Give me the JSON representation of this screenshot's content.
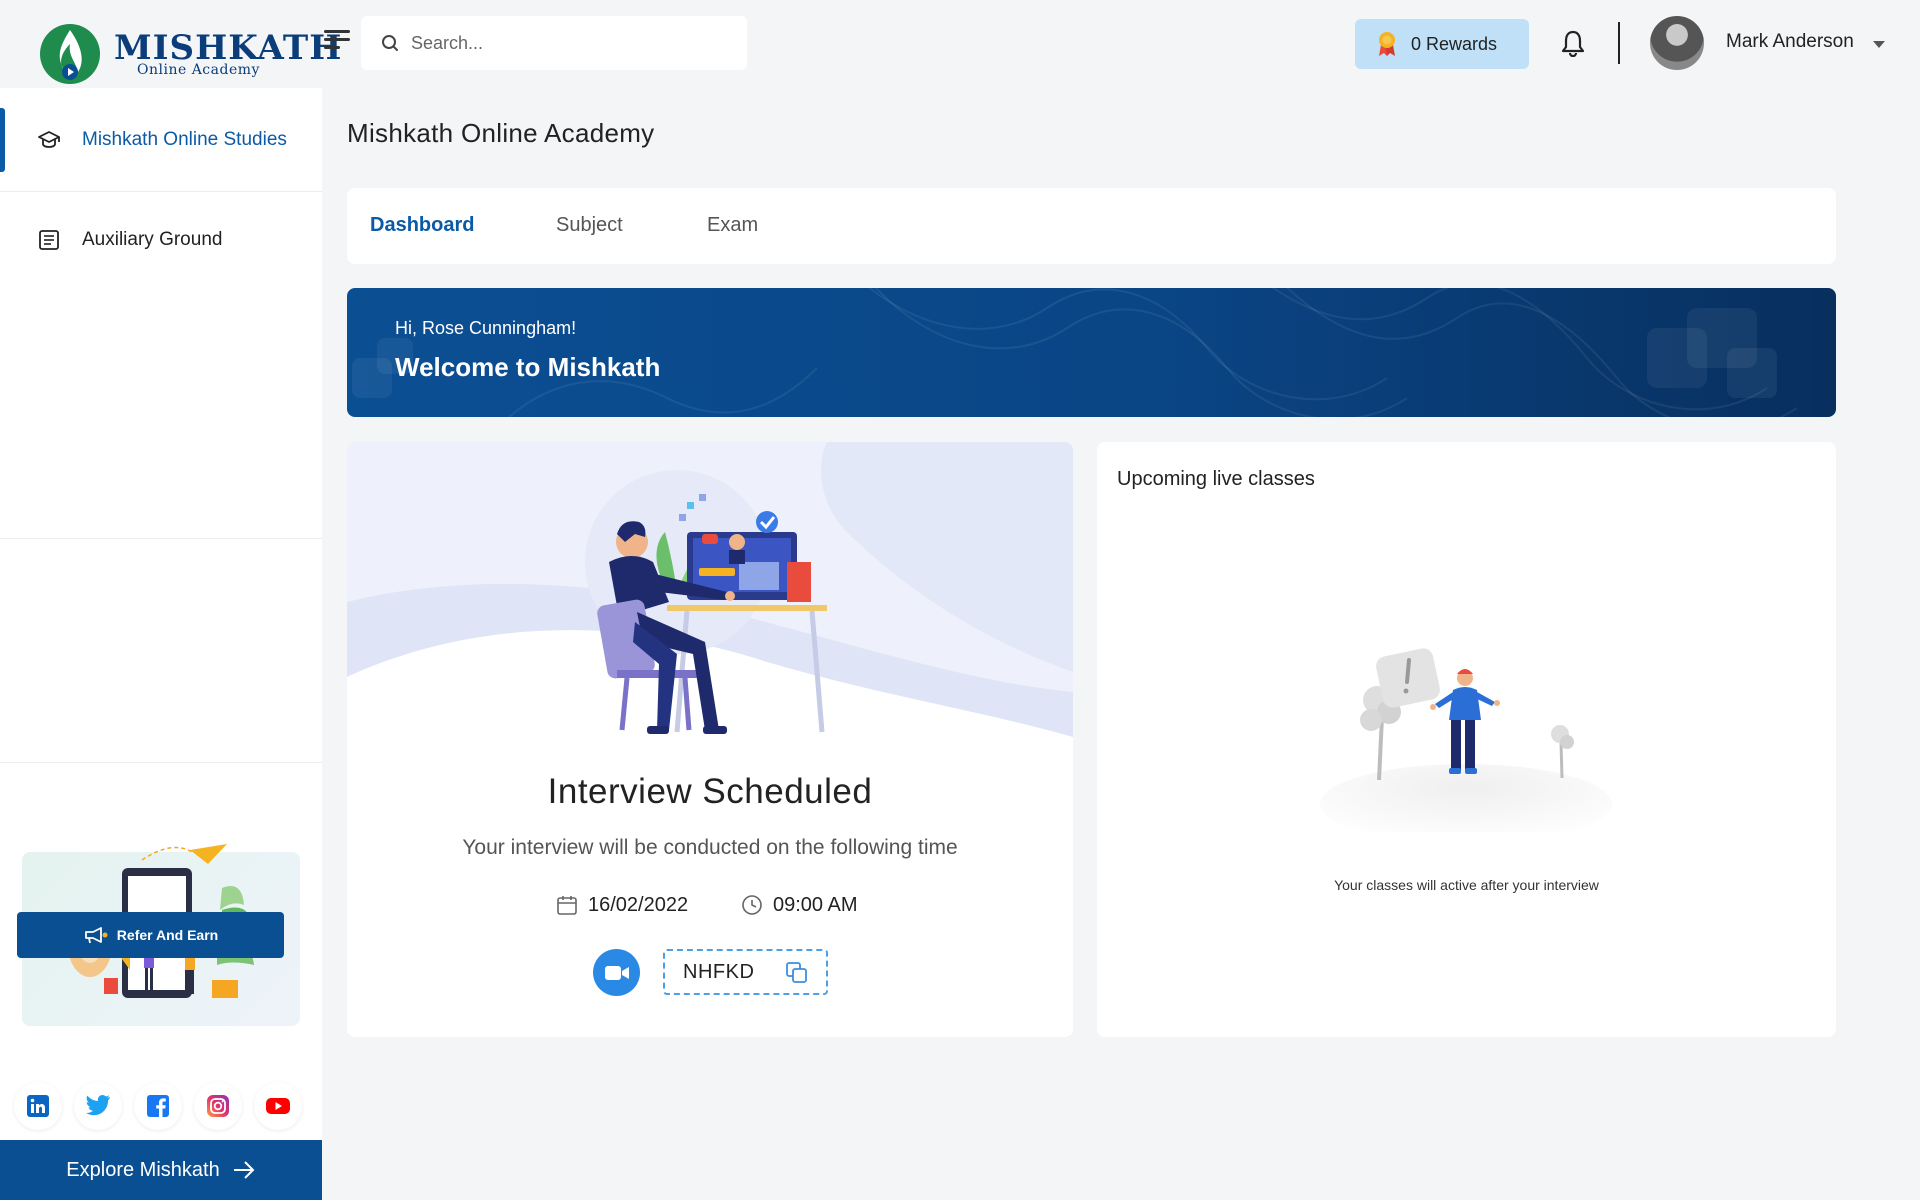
{
  "brand": {
    "name": "MISHKATH",
    "subtitle": "Online Academy",
    "color_primary": "#0b4f93",
    "color_accent": "#0b5aa8"
  },
  "header": {
    "search_placeholder": "Search...",
    "rewards_label": "0 Rewards",
    "user_name": "Mark Anderson",
    "icons": [
      "menu-icon",
      "search-icon",
      "award-icon",
      "bell-icon",
      "chevron-down-icon"
    ]
  },
  "sidebar": {
    "items": [
      {
        "label": "Mishkath Online Studies",
        "icon": "graduation-cap-icon",
        "active": true
      },
      {
        "label": "Auxiliary Ground",
        "icon": "document-icon",
        "active": false
      }
    ],
    "refer_label": "Refer And Earn",
    "socials": [
      "linkedin-icon",
      "twitter-icon",
      "facebook-icon",
      "instagram-icon",
      "youtube-icon"
    ],
    "explore_label": "Explore Mishkath"
  },
  "main": {
    "page_title": "Mishkath Online Academy",
    "tabs": [
      {
        "label": "Dashboard",
        "active": true
      },
      {
        "label": "Subject",
        "active": false
      },
      {
        "label": "Exam",
        "active": false
      }
    ],
    "banner": {
      "greeting": "Hi, Rose Cunningham!",
      "welcome": "Welcome to Mishkath"
    },
    "interview": {
      "title": "Interview Scheduled",
      "subtitle": "Your interview will be conducted on the following time",
      "date": "16/02/2022",
      "time": "09:00 AM",
      "code": "NHFKD"
    },
    "upcoming": {
      "title": "Upcoming live classes",
      "empty_note": "Your classes will active after your interview"
    }
  }
}
